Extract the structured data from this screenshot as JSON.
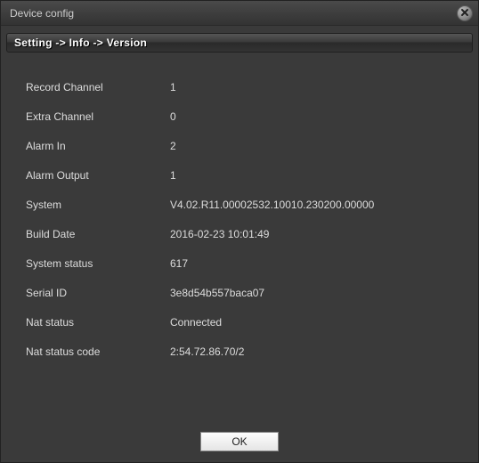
{
  "window": {
    "title": "Device config"
  },
  "breadcrumb": {
    "text": "Setting -> Info -> Version"
  },
  "info": {
    "rows": [
      {
        "label": "Record Channel",
        "value": "1"
      },
      {
        "label": "Extra Channel",
        "value": "0"
      },
      {
        "label": "Alarm In",
        "value": "2"
      },
      {
        "label": "Alarm Output",
        "value": "1"
      },
      {
        "label": "System",
        "value": "V4.02.R11.00002532.10010.230200.00000"
      },
      {
        "label": "Build Date",
        "value": "2016-02-23 10:01:49"
      },
      {
        "label": "System status",
        "value": "617"
      },
      {
        "label": "Serial ID",
        "value": " 3e8d54b557baca07"
      },
      {
        "label": "Nat status",
        "value": "Connected"
      },
      {
        "label": "Nat status code",
        "value": "2:54.72.86.70/2"
      }
    ]
  },
  "footer": {
    "ok_label": "OK"
  }
}
